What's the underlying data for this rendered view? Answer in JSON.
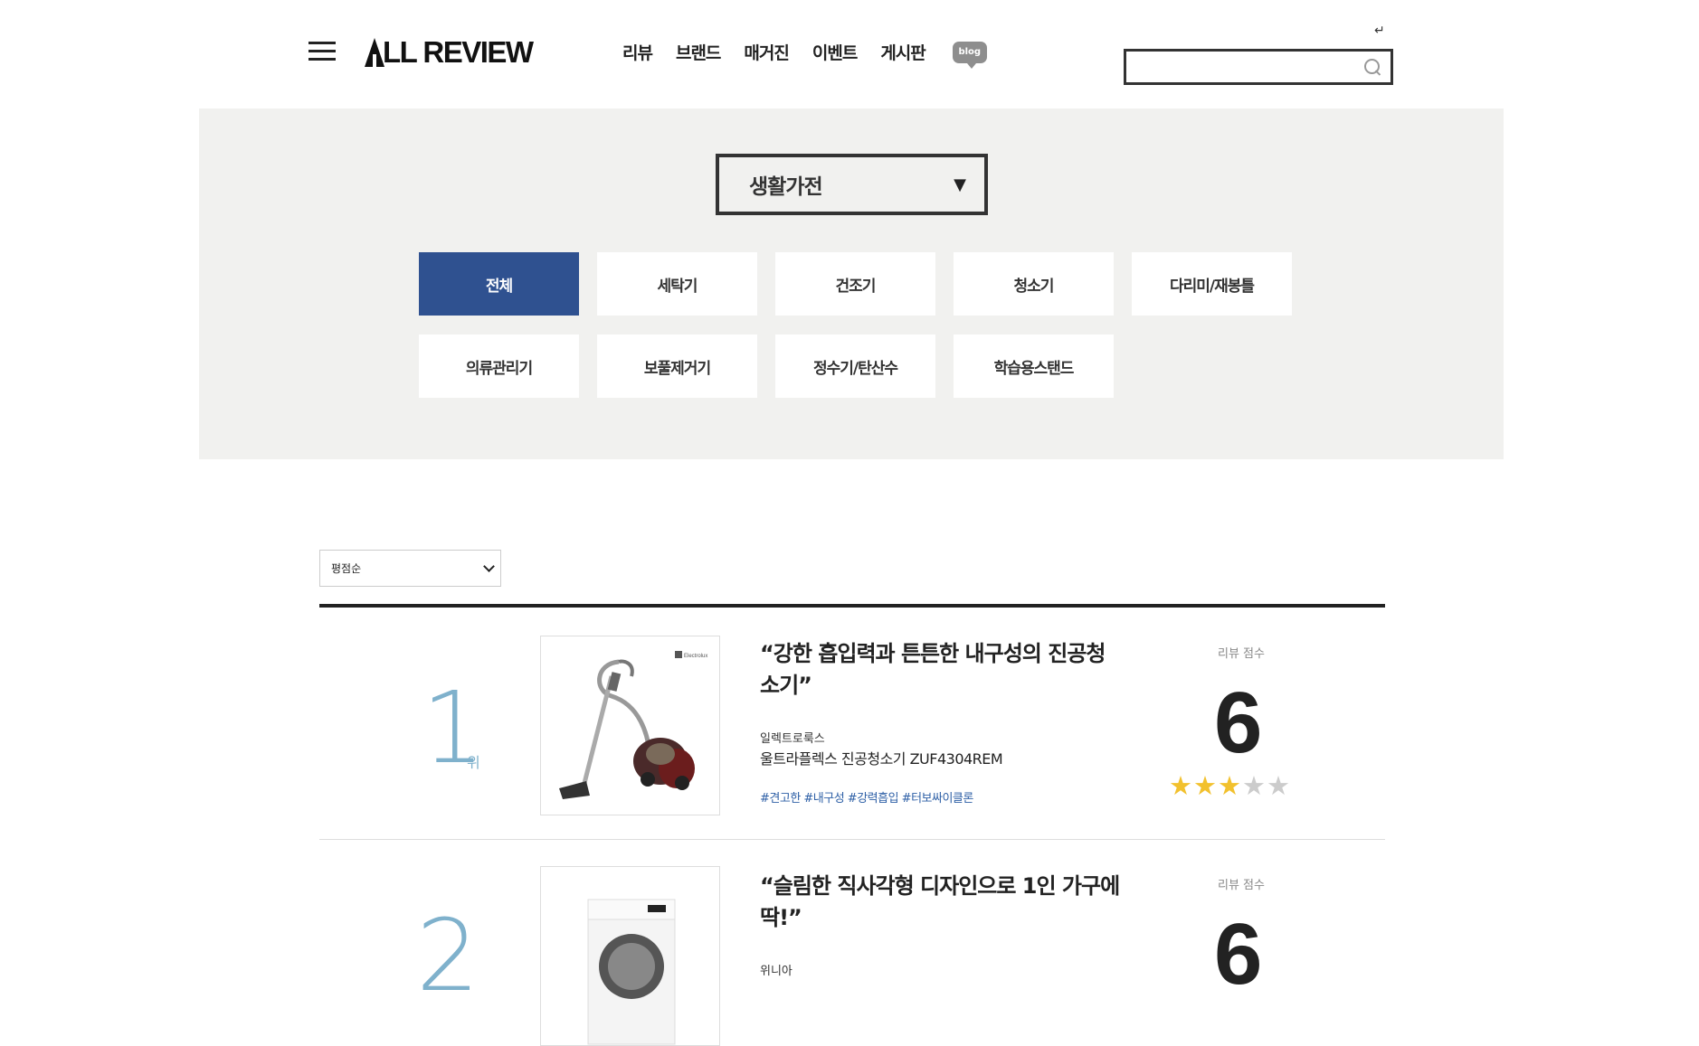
{
  "header": {
    "logo_text": "LL REVIEW",
    "nav": [
      "리뷰",
      "브랜드",
      "매거진",
      "이벤트",
      "게시판"
    ],
    "blog_label": "blog",
    "login_icon": "↵",
    "search_placeholder": ""
  },
  "categories": {
    "selected_group": "생활가전",
    "items": [
      "전체",
      "세탁기",
      "건조기",
      "청소기",
      "다리미/재봉틀",
      "의류관리기",
      "보풀제거기",
      "정수기/탄산수",
      "학습용스탠드"
    ],
    "active": "전체"
  },
  "sort": {
    "value": "평점순"
  },
  "reviews": [
    {
      "rank": "1",
      "rank_unit": "위",
      "title": "“강한 흡입력과 튼튼한 내구성의 진공청소기”",
      "brand": "일렉트로룩스",
      "product": "울트라플렉스 진공청소기 ZUF4304REM",
      "tags": "#견고한 #내구성 #강력흡입 #터보싸이클론",
      "score_label": "리뷰 점수",
      "score": "6",
      "stars": 3,
      "image_brand": "Electrolux"
    },
    {
      "rank": "2",
      "title": "“슬림한 직사각형 디자인으로 1인 가구에 딱!”",
      "brand": "위니아",
      "score_label": "리뷰 점수",
      "score": "6"
    }
  ],
  "colors": {
    "accent": "#2f5190",
    "panel": "#f1f1ef",
    "star": "#f2c12e",
    "tag": "#2d5fa6",
    "rank": "#7fb1cc"
  }
}
